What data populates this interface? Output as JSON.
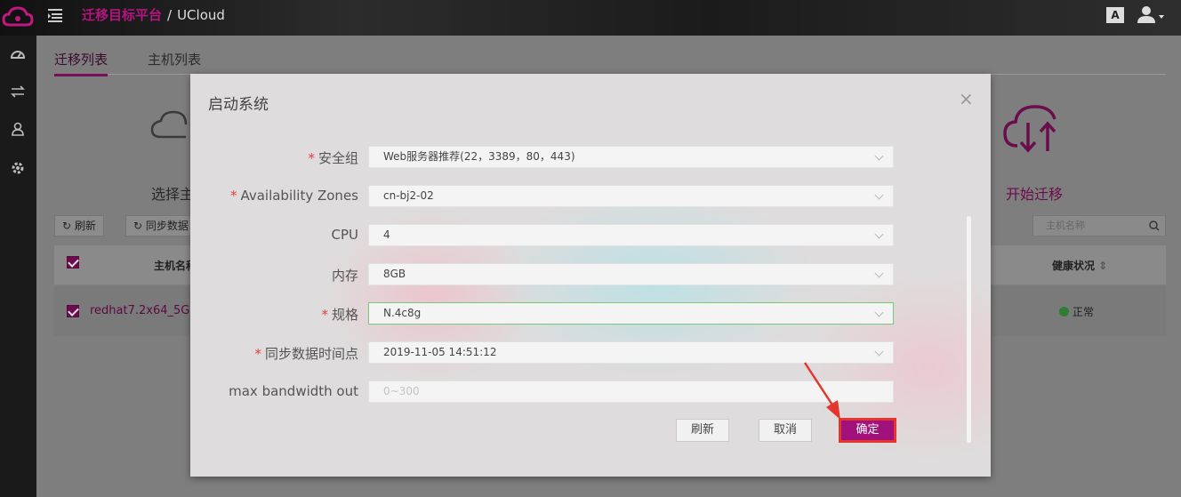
{
  "header": {
    "platform_title": "迁移目标平台",
    "separator": "/",
    "cloud_name": "UCloud",
    "font_size_icon_label": "A",
    "icons": [
      "cloud-logo-icon",
      "menu-toggle-icon",
      "font-size-icon",
      "user-icon",
      "chevron-down-icon"
    ]
  },
  "sidebar": {
    "items": [
      "dashboard-icon",
      "transfer-icon",
      "user-icon",
      "settings-icon"
    ]
  },
  "main": {
    "tabs": [
      {
        "label": "迁移列表",
        "active": true
      },
      {
        "label": "主机列表",
        "active": false
      }
    ],
    "steps": {
      "select_host": "选择主",
      "start_migration": "开始迁移"
    },
    "toolbar": {
      "refresh": "刷新",
      "sync_data": "同步数据"
    },
    "search": {
      "placeholder": "主机名称"
    },
    "table": {
      "headers": {
        "host_name": "主机名称",
        "health": "健康状况"
      },
      "rows": [
        {
          "host_name": "redhat7.2x64_5G",
          "health": "正常",
          "checked": true
        }
      ]
    }
  },
  "modal": {
    "title": "启动系统",
    "close": "×",
    "fields": {
      "security_group": {
        "label": "安全组",
        "required": true,
        "value": "Web服务器推荐(22，3389，80，443)"
      },
      "availability_zones": {
        "label": "Availability Zones",
        "required": true,
        "value": "cn-bj2-02"
      },
      "cpu": {
        "label": "CPU",
        "required": false,
        "value": "4"
      },
      "memory": {
        "label": "内存",
        "required": false,
        "value": "8GB"
      },
      "spec": {
        "label": "规格",
        "required": true,
        "value": "N.4c8g"
      },
      "sync_time": {
        "label": "同步数据时间点",
        "required": true,
        "value": "2019-11-05 14:51:12"
      },
      "max_bandwidth": {
        "label": "max bandwidth out",
        "required": false,
        "value": "",
        "placeholder": "0~300"
      }
    },
    "buttons": {
      "refresh": "刷新",
      "cancel": "取消",
      "confirm": "确定"
    }
  },
  "colors": {
    "brand": "#b2157e",
    "primary_button": "#a1117c",
    "highlight_border": "#e4362c",
    "required_star": "#e43c3c",
    "focus_border": "#7ac77a"
  }
}
